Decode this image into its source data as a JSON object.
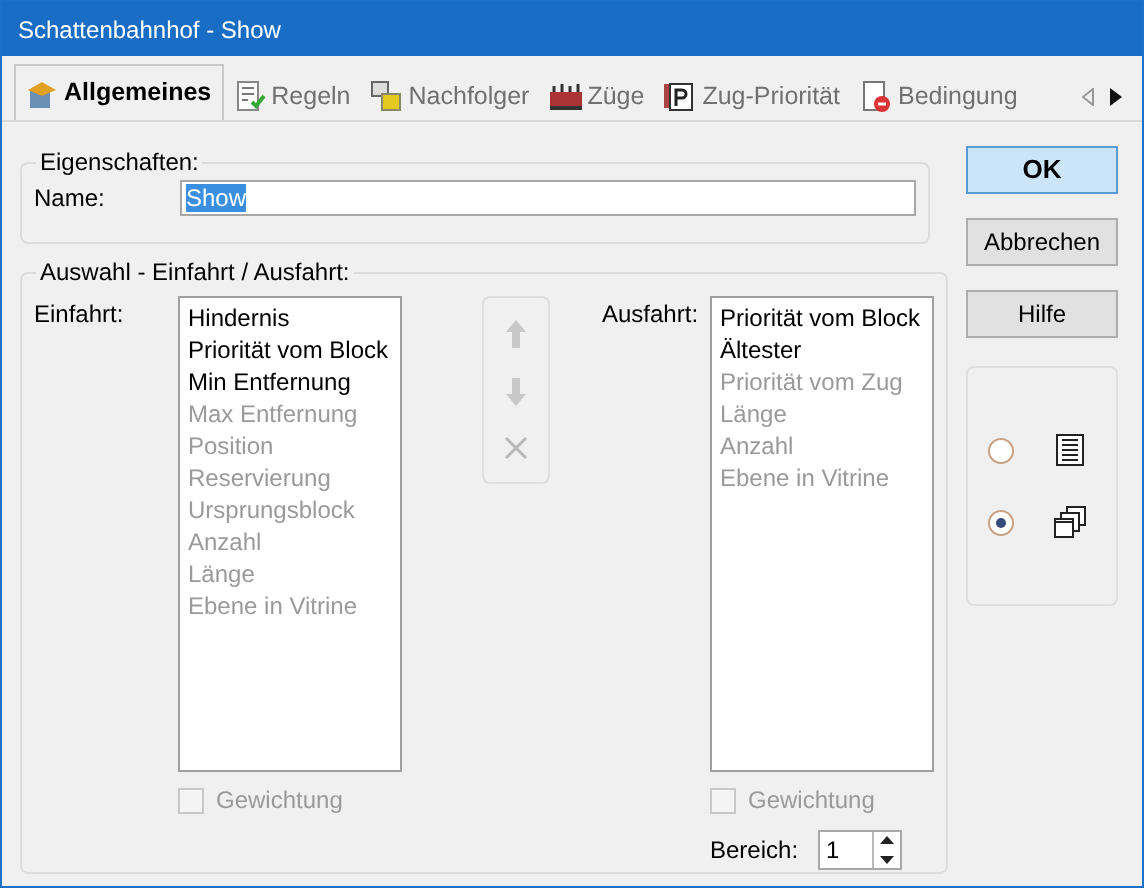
{
  "window": {
    "title": "Schattenbahnhof - Show"
  },
  "tabs": [
    {
      "label": "Allgemeines",
      "kind": "hat",
      "selected": true
    },
    {
      "label": "Regeln",
      "kind": "rules",
      "selected": false
    },
    {
      "label": "Nachfolger",
      "kind": "follow",
      "selected": false
    },
    {
      "label": "Züge",
      "kind": "trains",
      "selected": false
    },
    {
      "label": "Zug-Priorität",
      "kind": "priority",
      "selected": false
    },
    {
      "label": "Bedingung",
      "kind": "condition",
      "selected": false
    }
  ],
  "properties": {
    "legend": "Eigenschaften:",
    "name_label": "Name:",
    "name_value": "Show"
  },
  "selection": {
    "legend": "Auswahl - Einfahrt / Ausfahrt:",
    "entry": {
      "label": "Einfahrt:",
      "items": [
        {
          "text": "Hindernis",
          "enabled": true
        },
        {
          "text": "Priorität vom Block",
          "enabled": true
        },
        {
          "text": "Min Entfernung",
          "enabled": true
        },
        {
          "text": "Max Entfernung",
          "enabled": false
        },
        {
          "text": "Position",
          "enabled": false
        },
        {
          "text": "Reservierung",
          "enabled": false
        },
        {
          "text": "Ursprungsblock",
          "enabled": false
        },
        {
          "text": "Anzahl",
          "enabled": false
        },
        {
          "text": "Länge",
          "enabled": false
        },
        {
          "text": "Ebene in Vitrine",
          "enabled": false
        }
      ],
      "weighting": {
        "label": "Gewichtung",
        "checked": false,
        "disabled": true
      }
    },
    "exit": {
      "label": "Ausfahrt:",
      "items": [
        {
          "text": "Priorität vom Block",
          "enabled": true
        },
        {
          "text": "Ältester",
          "enabled": true
        },
        {
          "text": "Priorität vom Zug",
          "enabled": false
        },
        {
          "text": "Länge",
          "enabled": false
        },
        {
          "text": "Anzahl",
          "enabled": false
        },
        {
          "text": "Ebene in Vitrine",
          "enabled": false
        }
      ],
      "weighting": {
        "label": "Gewichtung",
        "checked": false,
        "disabled": true
      }
    },
    "range": {
      "label": "Bereich:",
      "value": "1"
    }
  },
  "buttons": [
    {
      "label": "OK",
      "default": true
    },
    {
      "label": "Abbrechen",
      "default": false
    },
    {
      "label": "Hilfe",
      "default": false
    }
  ],
  "view_options": [
    {
      "kind": "list",
      "selected": false
    },
    {
      "kind": "windows",
      "selected": true
    }
  ]
}
